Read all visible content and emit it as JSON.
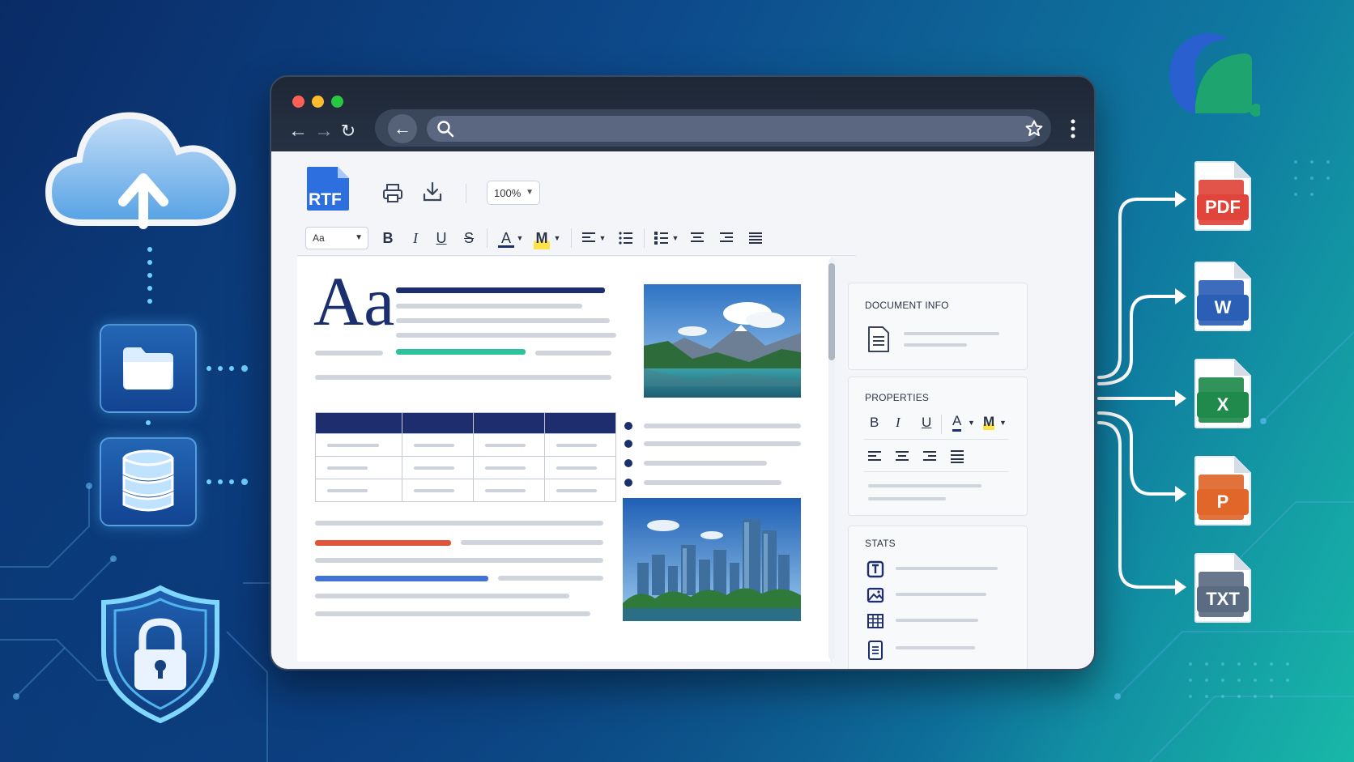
{
  "browser": {
    "url_value": "",
    "url_placeholder": ""
  },
  "toolbar": {
    "app_icon_label": "RTF",
    "zoom_value": "100%"
  },
  "format_bar": {
    "font_value": "Aa",
    "bold": "B",
    "italic": "I",
    "underline": "U",
    "strike": "S",
    "font_color": "A",
    "highlight": "M"
  },
  "document": {
    "heading_glyph": "Aa"
  },
  "panels": {
    "document_info": {
      "title": "DOCUMENT INFO"
    },
    "properties": {
      "title": "PROPERTIES",
      "bold": "B",
      "italic": "I",
      "underline": "U",
      "font_color": "A",
      "highlight": "M"
    },
    "stats": {
      "title": "STATS"
    }
  },
  "exports": [
    {
      "label": "PDF",
      "color": "#e0443a",
      "icon": "pdf-file-icon"
    },
    {
      "label": "W",
      "color": "#2b5fb5",
      "icon": "word-file-icon"
    },
    {
      "label": "X",
      "color": "#1f8a4c",
      "icon": "excel-file-icon"
    },
    {
      "label": "P",
      "color": "#e0662a",
      "icon": "powerpoint-file-icon"
    },
    {
      "label": "TXT",
      "color": "#5b6b82",
      "icon": "txt-file-icon"
    }
  ],
  "colors": {
    "accent_navy": "#1b2f6e",
    "accent_teal": "#2cc29b",
    "accent_red": "#e0553a",
    "accent_blue": "#3f73d6"
  }
}
